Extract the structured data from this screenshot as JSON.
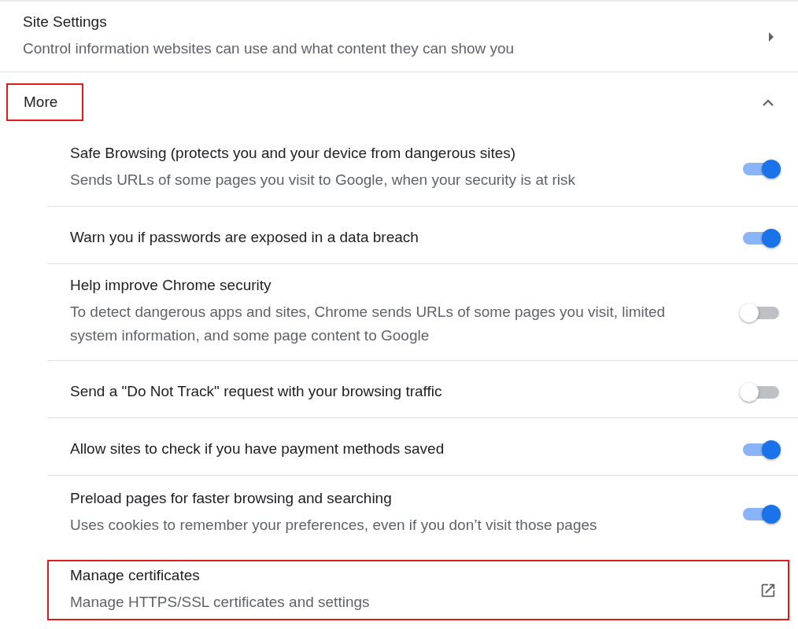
{
  "site_settings": {
    "title": "Site Settings",
    "description": "Control information websites can use and what content they can show you"
  },
  "more_section": {
    "title": "More",
    "expanded": true,
    "highlighted": true,
    "items": [
      {
        "kind": "toggle",
        "title": "Safe Browsing (protects you and your device from dangerous sites)",
        "description": "Sends URLs of some pages you visit to Google, when your security is at risk",
        "on": true
      },
      {
        "kind": "toggle",
        "title": "Warn you if passwords are exposed in a data breach",
        "on": true
      },
      {
        "kind": "toggle",
        "title": "Help improve Chrome security",
        "description": "To detect dangerous apps and sites, Chrome sends URLs of some pages you visit, limited system information, and some page content to Google",
        "on": false
      },
      {
        "kind": "toggle",
        "title": "Send a \"Do Not Track\" request with your browsing traffic",
        "on": false
      },
      {
        "kind": "toggle",
        "title": "Allow sites to check if you have payment methods saved",
        "on": true
      },
      {
        "kind": "toggle",
        "title": "Preload pages for faster browsing and searching",
        "description": "Uses cookies to remember your preferences, even if you don’t visit those pages",
        "on": true
      },
      {
        "kind": "link",
        "title": "Manage certificates",
        "description": "Manage HTTPS/SSL certificates and settings",
        "highlighted": true
      }
    ]
  }
}
